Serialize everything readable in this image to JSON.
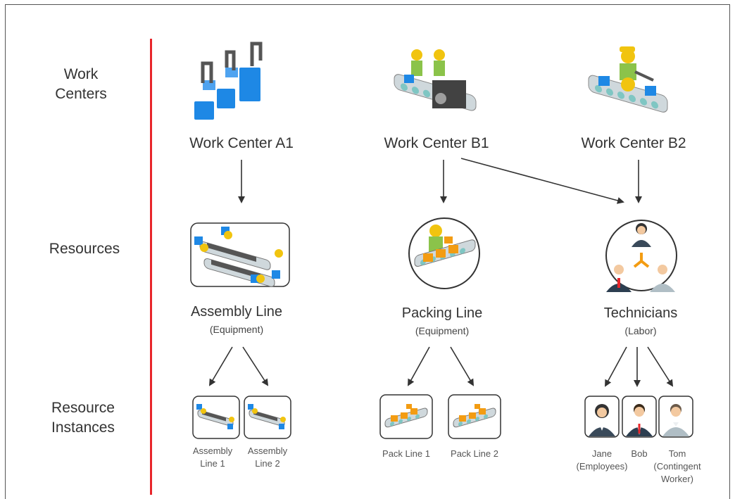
{
  "row_labels": {
    "work_centers": "Work\nCenters",
    "resources": "Resources",
    "resource_instances": "Resource\nInstances"
  },
  "work_centers": [
    {
      "label": "Work Center  A1"
    },
    {
      "label": "Work Center  B1"
    },
    {
      "label": "Work Center  B2"
    }
  ],
  "resources": [
    {
      "name": "Assembly Line",
      "type": "(Equipment)"
    },
    {
      "name": "Packing Line",
      "type": "(Equipment)"
    },
    {
      "name": "Technicians",
      "type": "(Labor)"
    }
  ],
  "instances": [
    {
      "label": "Assembly\nLine 1"
    },
    {
      "label": "Assembly\nLine 2"
    },
    {
      "label": "Pack Line 1"
    },
    {
      "label": "Pack Line 2"
    },
    {
      "label": "Jane\n(Employees)"
    },
    {
      "label": "Bob"
    },
    {
      "label": "Tom\n(Contingent\nWorker)"
    }
  ],
  "colors": {
    "divider": "#e8262b",
    "blue": "#1e88e5",
    "teal": "#7fc6c3",
    "orange": "#f39c12",
    "yellow": "#f1c40f",
    "green": "#8bc34a",
    "arrow": "#333333"
  }
}
